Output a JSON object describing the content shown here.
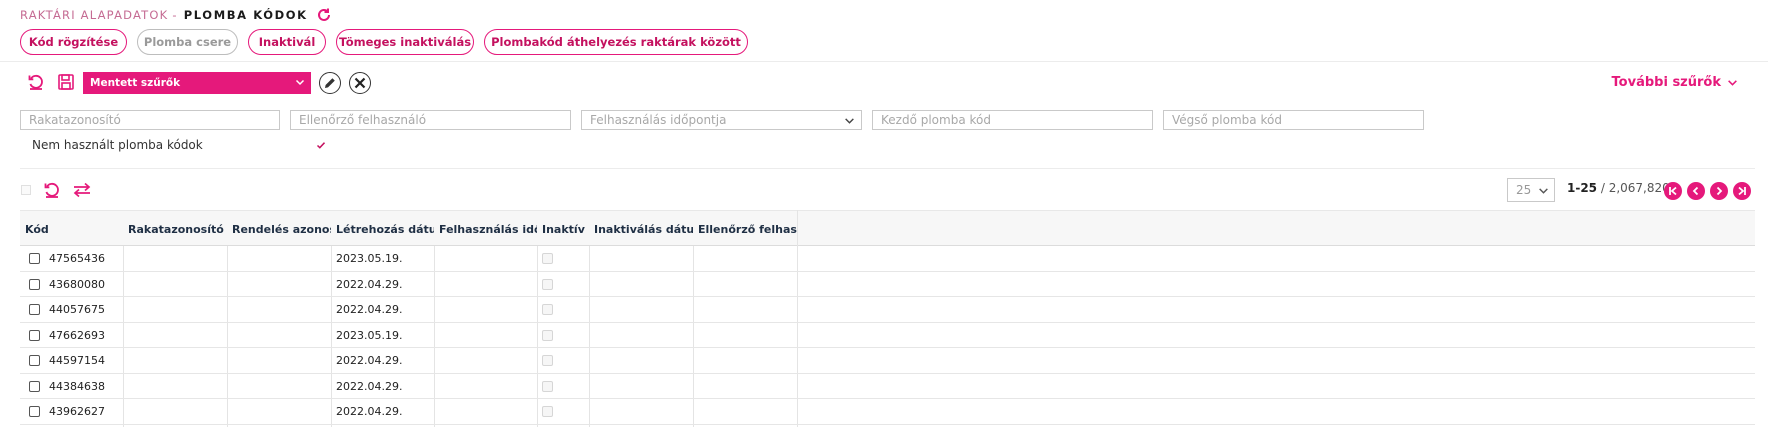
{
  "breadcrumb": {
    "parent": "RAKTÁRI ALAPADATOK",
    "separator": "-",
    "current": "PLOMBA KÓDOK",
    "refresh_icon": "refresh-icon"
  },
  "actions": [
    {
      "label": "Kód rögzítése",
      "disabled": false
    },
    {
      "label": "Plomba csere",
      "disabled": true
    },
    {
      "label": "Inaktivál",
      "disabled": false
    },
    {
      "label": "Tömeges inaktiválás",
      "disabled": false
    },
    {
      "label": "Plombakód áthelyezés raktárak között",
      "disabled": false
    }
  ],
  "saved_filters": {
    "selected": "Mentett szűrők",
    "reset_icon": "reset-icon",
    "save_icon": "save-icon",
    "edit_icon": "pencil-icon",
    "delete_icon": "close-icon"
  },
  "more_filters": {
    "label": "További szűrők",
    "icon": "chevron-down-icon"
  },
  "filters": {
    "warehouse_id": {
      "placeholder": "Rakatazonosító",
      "value": ""
    },
    "checker_user": {
      "placeholder": "Ellenőrző felhasználó",
      "value": ""
    },
    "usage_time": {
      "placeholder": "Felhasználás időpontja",
      "value": ""
    },
    "start_code": {
      "placeholder": "Kezdő plomba kód",
      "value": ""
    },
    "end_code": {
      "placeholder": "Végső plomba kód",
      "value": ""
    },
    "unused_only": {
      "label": "Nem használt plomba kódok",
      "checked": true
    }
  },
  "table_toolbar": {
    "refresh_icon": "reset-icon",
    "swap_icon": "swap-arrows-icon"
  },
  "pagination": {
    "page_size": "25",
    "range": "1-25",
    "separator": " / ",
    "total": "2,067,820",
    "first_icon": "first-page-icon",
    "prev_icon": "prev-page-icon",
    "next_icon": "next-page-icon",
    "last_icon": "last-page-icon"
  },
  "table": {
    "columns": [
      "Kód",
      "Rakatazonosító",
      "Rendelés azonosító",
      "Létrehozás dátuma",
      "Felhasználás időpontja",
      "Inaktív",
      "Inaktiválás dátuma",
      "Ellenőrző felhasználó"
    ],
    "rows": [
      {
        "code": "47565436",
        "warehouse": "",
        "order": "",
        "created": "2023.05.19.",
        "used": "",
        "inactive": false,
        "inactivated": "",
        "checker": ""
      },
      {
        "code": "43680080",
        "warehouse": "",
        "order": "",
        "created": "2022.04.29.",
        "used": "",
        "inactive": false,
        "inactivated": "",
        "checker": ""
      },
      {
        "code": "44057675",
        "warehouse": "",
        "order": "",
        "created": "2022.04.29.",
        "used": "",
        "inactive": false,
        "inactivated": "",
        "checker": ""
      },
      {
        "code": "47662693",
        "warehouse": "",
        "order": "",
        "created": "2023.05.19.",
        "used": "",
        "inactive": false,
        "inactivated": "",
        "checker": ""
      },
      {
        "code": "44597154",
        "warehouse": "",
        "order": "",
        "created": "2022.04.29.",
        "used": "",
        "inactive": false,
        "inactivated": "",
        "checker": ""
      },
      {
        "code": "44384638",
        "warehouse": "",
        "order": "",
        "created": "2022.04.29.",
        "used": "",
        "inactive": false,
        "inactivated": "",
        "checker": ""
      },
      {
        "code": "43962627",
        "warehouse": "",
        "order": "",
        "created": "2022.04.29.",
        "used": "",
        "inactive": false,
        "inactivated": "",
        "checker": ""
      }
    ]
  },
  "colors": {
    "accent": "#e5197b",
    "accent_text": "#c4115f",
    "header_text": "#1f2f44"
  }
}
